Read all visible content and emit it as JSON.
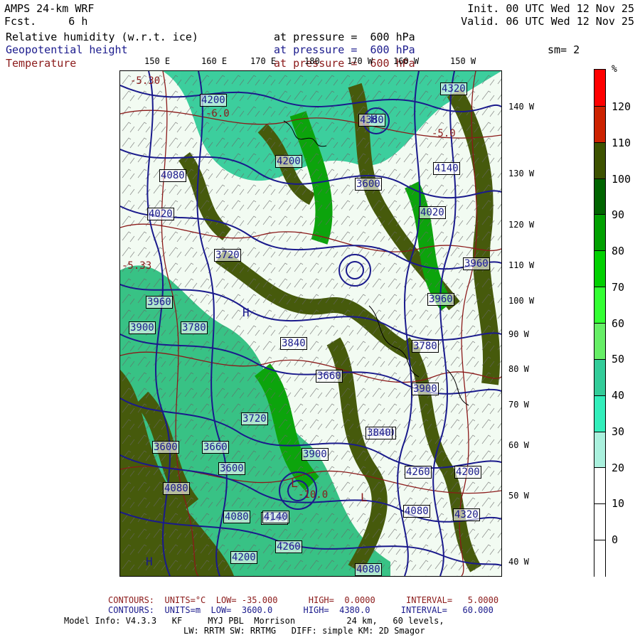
{
  "header": {
    "model": "AMPS 24-km WRF",
    "forecast": "Fcst.     6 h",
    "init": "Init. 00 UTC Wed 12 Nov 25",
    "valid": "Valid. 06 UTC Wed 12 Nov 25",
    "smoothing": "sm= 2"
  },
  "fields": [
    {
      "name": "Relative humidity (w.r.t. ice)",
      "level": "at pressure =  600 hPa",
      "color": "#000000"
    },
    {
      "name": "Geopotential height",
      "level": "at pressure =  600 hPa",
      "color": "#1a1a8c"
    },
    {
      "name": "Temperature",
      "level": "at pressure =  600 hPa",
      "color": "#8b1a1a"
    }
  ],
  "longitude_labels": [
    "150 E",
    "160 E",
    "170 E",
    "180",
    "170 W",
    "160 W",
    "150 W"
  ],
  "latitude_labels": [
    "140 W",
    "130 W",
    "120 W",
    "110 W",
    "100 W",
    "90 W",
    "80 W",
    "70 W",
    "60 W",
    "50 W",
    "40 W"
  ],
  "colorbar": {
    "unit": "%",
    "labels": [
      "120",
      "110",
      "100",
      "90",
      "80",
      "70",
      "60",
      "50",
      "40",
      "30",
      "20",
      "10",
      "0"
    ],
    "colors": [
      "#ff0000",
      "#cc2200",
      "#3d5200",
      "#006400",
      "#00a000",
      "#00d000",
      "#33ff33",
      "#66ee66",
      "#33cc99",
      "#33eebb",
      "#aaf0dd",
      "#ffffff",
      "#ffffff",
      "#ffffff"
    ]
  },
  "map_labels": {
    "heights": [
      "4200",
      "4320",
      "4140",
      "4080",
      "4020",
      "3960",
      "3900",
      "3840",
      "3780",
      "3720",
      "3660",
      "3600",
      "4260",
      "4380",
      "4140",
      "4080",
      "3960",
      "3900",
      "3840",
      "3780",
      "3720",
      "3660",
      "3600",
      "4140",
      "4080",
      "4200",
      "4260",
      "4320",
      "4080",
      "4200",
      "3840",
      "3600",
      "3900",
      "3960",
      "4020",
      "4080",
      "4200"
    ],
    "temps": [
      "-5.30",
      "-5.0",
      "-6.0",
      "-5.33",
      "-10.0"
    ],
    "highs": [
      "H",
      "H",
      "H"
    ],
    "lows": [
      "L",
      "L"
    ]
  },
  "footer": {
    "temp_contours": "CONTOURS:  UNITS=°C  LOW= -35.000      HIGH=  0.0000      INTERVAL=   5.0000",
    "height_contours": "CONTOURS:  UNITS=m  LOW=  3600.0      HIGH=  4380.0      INTERVAL=   60.000",
    "model_info_1": "Model Info: V4.3.3   KF     MYJ PBL  Morrison          24 km,   60 levels,",
    "model_info_2": "LW: RRTM SW: RRTMG   DIFF: simple KM: 2D Smagor"
  }
}
